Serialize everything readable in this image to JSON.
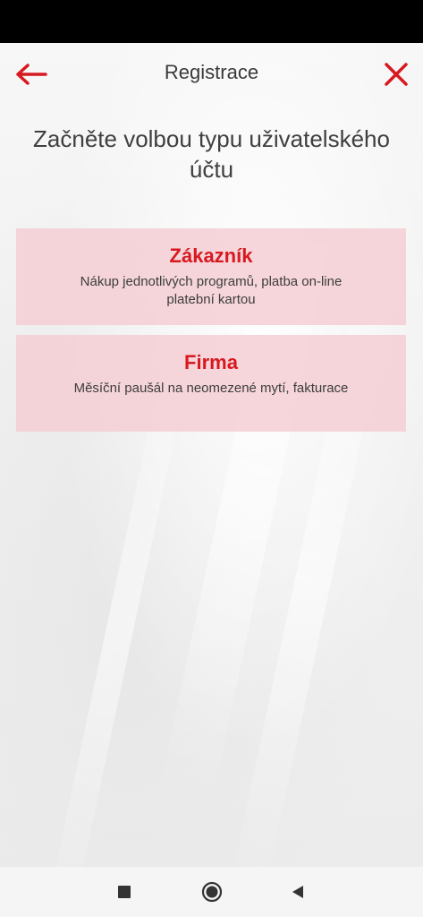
{
  "header": {
    "title": "Registrace",
    "back_icon": "arrow-left-icon",
    "close_icon": "close-icon"
  },
  "intro": {
    "text": "Začněte volbou typu uživatelského účtu"
  },
  "options": [
    {
      "title": "Zákazník",
      "description": "Nákup jednotlivých programů, platba on-line platební kartou"
    },
    {
      "title": "Firma",
      "description": "Měsíční paušál na neomezené mytí, fakturace"
    }
  ],
  "nav": {
    "recents_icon": "square-icon",
    "home_icon": "circle-icon",
    "back_icon": "triangle-back-icon"
  },
  "colors": {
    "accent": "#d71920",
    "card": "#f4cdd2",
    "text": "#3f3f3f"
  }
}
